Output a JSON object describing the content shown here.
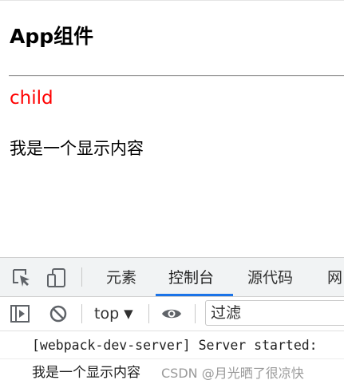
{
  "page": {
    "title": "App组件",
    "child_label": "child",
    "child_color": "#ff0000",
    "content_text": "我是一个显示内容"
  },
  "devtools": {
    "tabs": [
      {
        "label": "元素",
        "active": false
      },
      {
        "label": "控制台",
        "active": true
      },
      {
        "label": "源代码",
        "active": false
      },
      {
        "label": "网",
        "active": false
      }
    ],
    "toolbar": {
      "context_value": "top",
      "filter_placeholder": "过滤"
    },
    "console_messages": [
      "[webpack-dev-server] Server started:",
      "我是一个显示内容"
    ],
    "accent_color": "#1a73e8"
  },
  "watermark": "CSDN @月光晒了很凉快"
}
